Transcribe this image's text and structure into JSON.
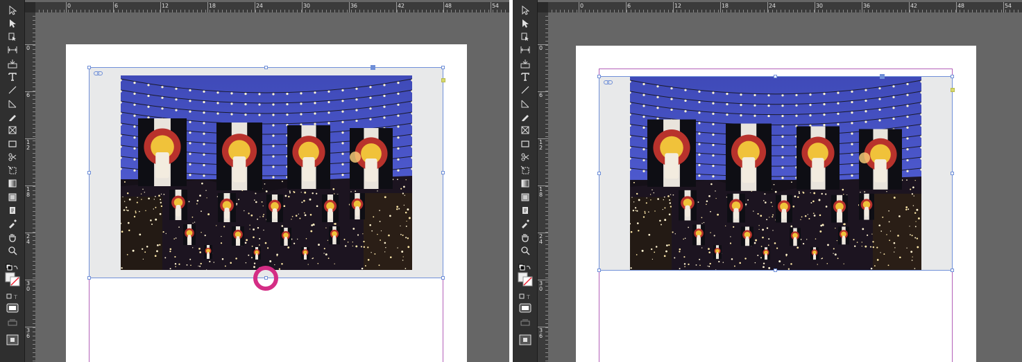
{
  "colors": {
    "workspace": "#666666",
    "toolbar": "#2f2f2f",
    "frame_selection": "#6f8fd8",
    "margin_guide": "#b35fb8",
    "highlight": "#d42d85",
    "sky": "#4a55c7"
  },
  "ruler": {
    "horizontal_labels": [
      "0",
      "6",
      "12",
      "18",
      "24",
      "30",
      "36",
      "42",
      "48",
      "54"
    ],
    "vertical_labels": [
      "0",
      "6",
      "1 2",
      "1 8",
      "2 4",
      "3 0",
      "3 6"
    ]
  },
  "tools": [
    "selection-tool-icon",
    "direct-selection-tool-icon",
    "page-tool-icon",
    "gap-tool-icon",
    "content-collector-icon",
    "type-tool-icon",
    "line-tool-icon",
    "pen-tool-icon",
    "pencil-tool-icon",
    "rectangle-frame-tool-icon",
    "rectangle-tool-icon",
    "scissors-tool-icon",
    "free-transform-tool-icon",
    "gradient-swatch-tool-icon",
    "gradient-feather-tool-icon",
    "note-tool-icon",
    "eyedropper-tool-icon",
    "hand-tool-icon",
    "zoom-tool-icon"
  ],
  "panels": [
    {
      "id": "before",
      "state": "frame-extended-below-image"
    },
    {
      "id": "after",
      "state": "frame-fitted-to-image"
    }
  ]
}
